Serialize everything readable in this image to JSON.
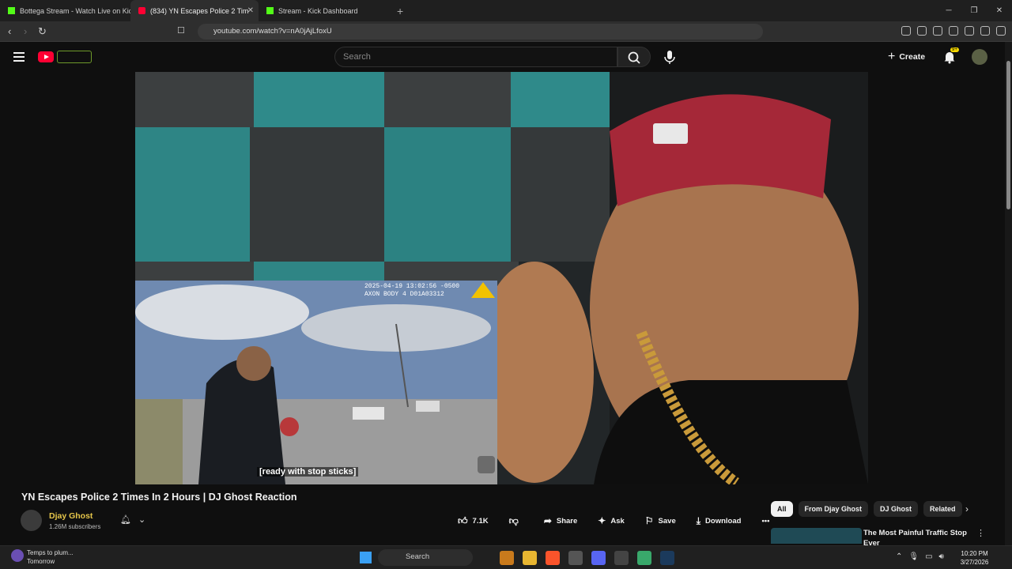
{
  "browser": {
    "tabs": [
      {
        "title": "Bottega Stream - Watch Live on Kick",
        "favicon": "kick-logo-icon"
      },
      {
        "title": "(834) YN Escapes Police 2 Tim",
        "favicon": "youtube-logo-icon"
      },
      {
        "title": "Stream - Kick Dashboard",
        "favicon": "kick-logo-icon"
      }
    ],
    "url": "youtube.com/watch?v=nA0jAjLfoxU"
  },
  "youtube": {
    "search_placeholder": "Search",
    "create_label": "Create",
    "notification_count": "9+"
  },
  "video": {
    "timestamp_line1": "2025-04-19 13:02:56 -0500",
    "timestamp_line2": "AXON BODY 4 D01A03312",
    "caption": "[ready with stop sticks]",
    "title": "YN Escapes Police 2 Times In 2 Hours | DJ Ghost Reaction",
    "channel_name": "Djay Ghost",
    "subscribers": "1.26M subscribers",
    "likes": "7.1K",
    "share_label": "Share",
    "ask_label": "Ask",
    "save_label": "Save",
    "download_label": "Download"
  },
  "chips": [
    "All",
    "From Djay Ghost",
    "DJ Ghost",
    "Related"
  ],
  "recommendation": {
    "title": "The Most Painful Traffic Stop Ever"
  },
  "taskbar": {
    "weather_line1": "Temps to plum...",
    "weather_line2": "Tomorrow",
    "search_label": "Search",
    "time": "10:20 PM",
    "date": "3/27/2026"
  },
  "colors": {
    "youtube_red": "#ff0033",
    "kick_green": "#53fc18",
    "channel_name": "#e6c64a",
    "background": "#0f0f0f"
  }
}
